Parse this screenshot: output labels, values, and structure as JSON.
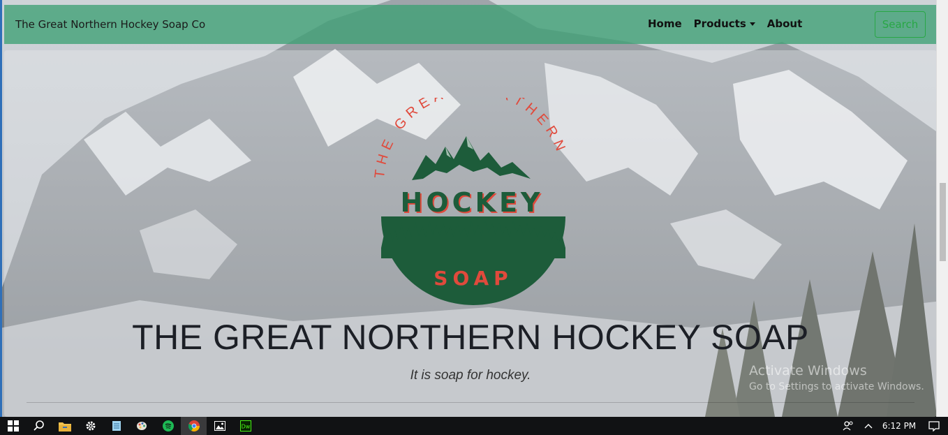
{
  "navbar": {
    "brand": "The Great Northern Hockey Soap Co",
    "links": [
      "Home",
      "Products",
      "About"
    ],
    "search_label": "Search"
  },
  "logo": {
    "arc_text": "THE GREAT NORTHERN",
    "word1": "HOCKEY",
    "word2": "SOAP"
  },
  "hero": {
    "title": "THE GREAT NORTHERN HOCKEY SOAP",
    "tagline": "It is soap for hockey."
  },
  "watermark": {
    "line1": "Activate Windows",
    "line2": "Go to Settings to activate Windows."
  },
  "taskbar": {
    "apps": [
      "windows-start-icon",
      "search-icon",
      "file-explorer-icon",
      "settings-gear-icon",
      "notepad-icon",
      "paint-icon",
      "spotify-icon",
      "chrome-icon",
      "photos-icon",
      "dreamweaver-icon"
    ],
    "time": "6:12 PM"
  },
  "colors": {
    "navbar": "#3da074",
    "logo_green": "#1d5c3a",
    "logo_red": "#e04a3c",
    "search_outline": "#28a745"
  }
}
